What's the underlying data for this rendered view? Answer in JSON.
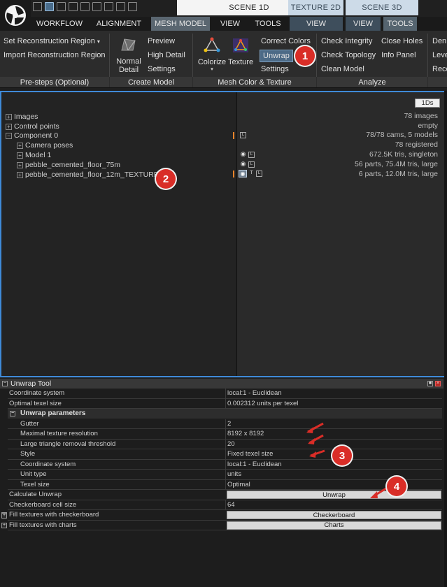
{
  "scene_tabs": [
    "SCENE 1D",
    "TEXTURE 2D",
    "SCENE 3D"
  ],
  "ribbon_tabs": [
    "WORKFLOW",
    "ALIGNMENT",
    "MESH MODEL",
    "VIEW",
    "TOOLS",
    "VIEW",
    "VIEW",
    "TOOLS"
  ],
  "ribbon": {
    "set_region": "Set Reconstruction Region",
    "import_region": "Import Reconstruction Region",
    "normal_detail_line1": "Normal",
    "normal_detail_line2": "Detail",
    "preview": "Preview",
    "high_detail": "High Detail",
    "settings": "Settings",
    "colorize": "Colorize",
    "texture": "Texture",
    "correct_colors": "Correct Colors",
    "unwrap": "Unwrap",
    "settings2": "Settings",
    "check_integrity": "Check Integrity",
    "check_topology": "Check Topology",
    "clean_model": "Clean Model",
    "close_holes": "Close Holes",
    "info_panel": "Info Panel",
    "den": "Den",
    "leve": "Leve",
    "reco": "Reco",
    "groups": [
      "Pre-steps (Optional)",
      "Create Model",
      "Mesh Color & Texture",
      "Analyze"
    ]
  },
  "badges": [
    "1",
    "2",
    "3",
    "4"
  ],
  "tree": {
    "images": "Images",
    "control_points": "Control points",
    "component": "Component 0",
    "camera_poses": "Camera poses",
    "model1": "Model 1",
    "floor75": "pebble_cemented_floor_75m",
    "floor12": "pebble_cemented_floor_12m_TEXTURED"
  },
  "info": {
    "btn_1ds": "1Ds",
    "images": "78 images",
    "control_points": "empty",
    "component": "78/78 cams, 5 models",
    "camera_poses": "78 registered",
    "model1": "672.5K tris, singleton",
    "floor75": "56 parts, 75.4M tris, large",
    "floor12": "6 parts, 12.0M tris, large"
  },
  "tool": {
    "title": "Unwrap Tool",
    "rows": {
      "coord_label": "Coordinate system",
      "coord_value": "local:1 - Euclidean",
      "optimal_label": "Optimal texel size",
      "optimal_value": "0.002312 units per texel",
      "section": "Unwrap parameters",
      "gutter_label": "Gutter",
      "gutter_value": "2",
      "maxres_label": "Maximal texture resolution",
      "maxres_value": "8192 x 8192",
      "large_tri_label": "Large triangle removal threshold",
      "large_tri_value": "20",
      "style_label": "Style",
      "style_value": "Fixed texel size",
      "coord2_label": "Coordinate system",
      "coord2_value": "local:1 - Euclidean",
      "unit_label": "Unit type",
      "unit_value": "units",
      "texel_label": "Texel size",
      "texel_value": "Optimal",
      "calc_label": "Calculate Unwrap",
      "calc_btn": "Unwrap",
      "checker_cell_label": "Checkerboard cell size",
      "checker_cell_value": "64",
      "fill_checker_label": "Fill textures with checkerboard",
      "fill_checker_btn": "Checkerboard",
      "fill_charts_label": "Fill textures with charts",
      "fill_charts_btn": "Charts"
    }
  },
  "colors": {
    "accent_blue": "#3f8ad8",
    "badge_red": "#d92d27",
    "marker_orange": "#e8842a"
  }
}
